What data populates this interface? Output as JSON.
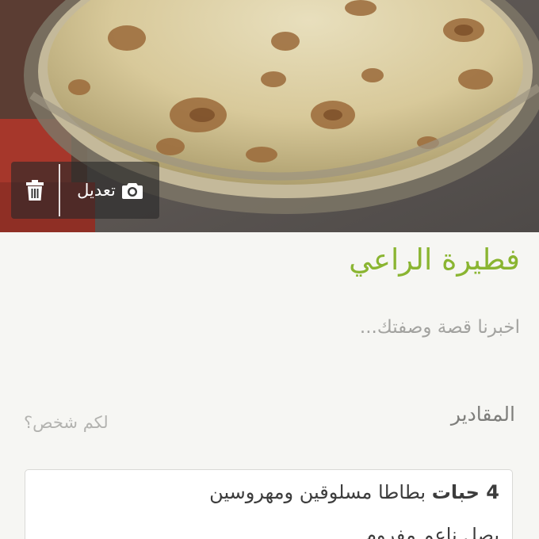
{
  "photo": {
    "image_name": "recipe-photo"
  },
  "photo_actions": {
    "edit_label": "تعديل",
    "edit_icon": "camera-icon",
    "delete_icon": "trash-icon"
  },
  "recipe": {
    "title": "فطيرة الراعي",
    "story_placeholder": "اخبرنا قصة وصفتك..."
  },
  "ingredients": {
    "heading": "المقادير",
    "servings_placeholder": "لكم شخص؟",
    "items": [
      {
        "quantity": "4 حبات",
        "text": " بطاطا مسلوقين ومهروسين"
      },
      {
        "quantity": "",
        "text": "بصل ناعم مفروم"
      }
    ]
  },
  "colors": {
    "title_accent": "#8ab531",
    "background": "#f6f6f3"
  }
}
